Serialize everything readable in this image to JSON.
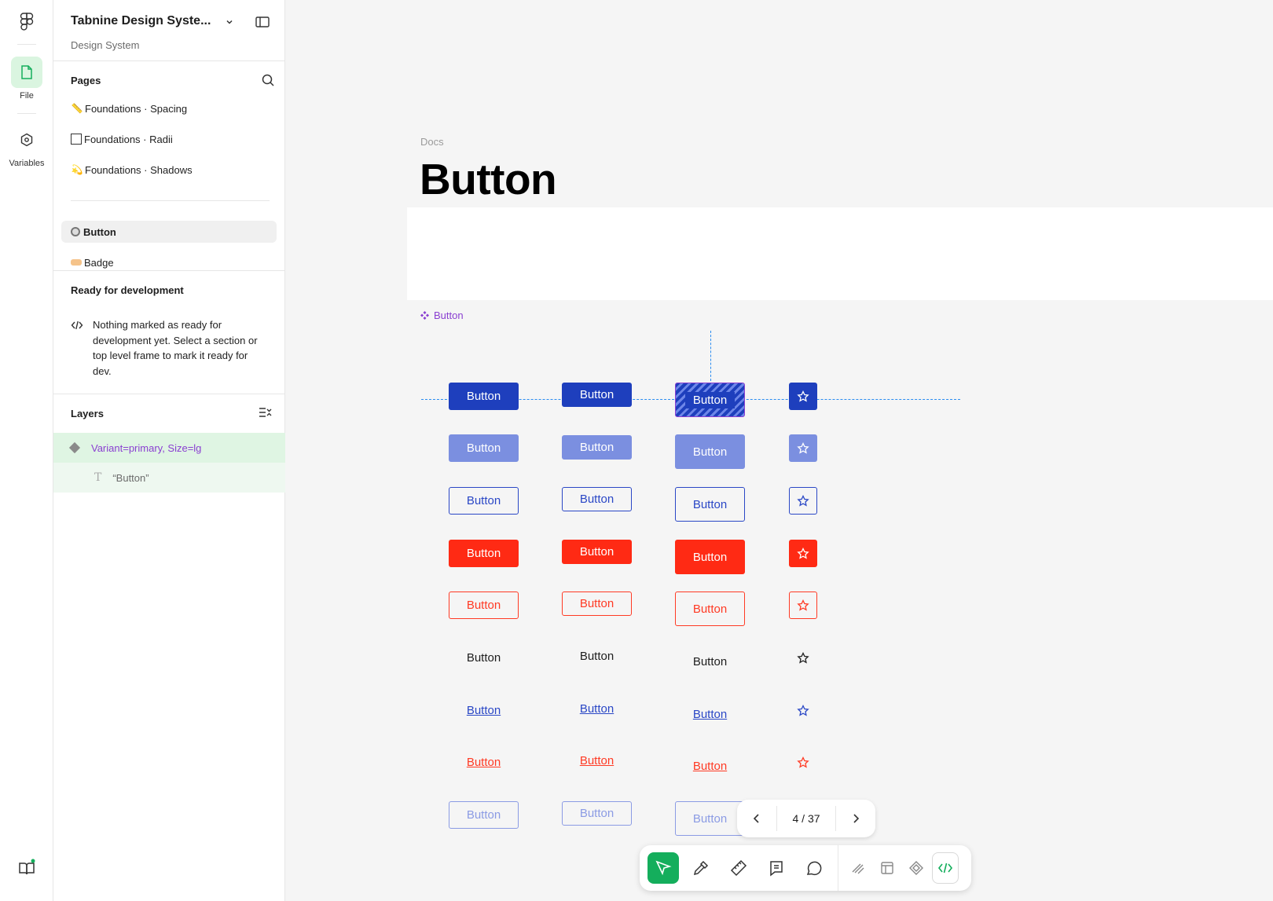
{
  "rail": {
    "file_label": "File",
    "variables_label": "Variables"
  },
  "sidebar": {
    "file_title": "Tabnine Design Syste...",
    "file_subtitle": "Design System",
    "pages_title": "Pages",
    "pages": [
      {
        "emoji": "📏",
        "label": "Foundations · Spacing"
      },
      {
        "emoji": "",
        "label": "Foundations · Radii"
      },
      {
        "emoji": "💫",
        "label": "Foundations · Shadows"
      },
      {
        "emoji": "",
        "label": "Button"
      },
      {
        "emoji": "",
        "label": "Badge"
      }
    ],
    "ready_title": "Ready for development",
    "ready_text": "Nothing marked as ready for development yet. Select a section or top level frame to mark it ready for dev.",
    "layers_title": "Layers",
    "layers": [
      {
        "label": "Variant=primary, Size=lg"
      },
      {
        "label": "“Button”"
      }
    ]
  },
  "canvas": {
    "breadcrumb": "Docs",
    "title": "Button",
    "component_label": "Button",
    "button_text": "Button"
  },
  "pager": {
    "count": "4 / 37"
  },
  "colors": {
    "primary": "#1e3fbd",
    "danger": "#ff2a14",
    "accent_green": "#14ae5c",
    "component_purple": "#8a3fd1"
  }
}
